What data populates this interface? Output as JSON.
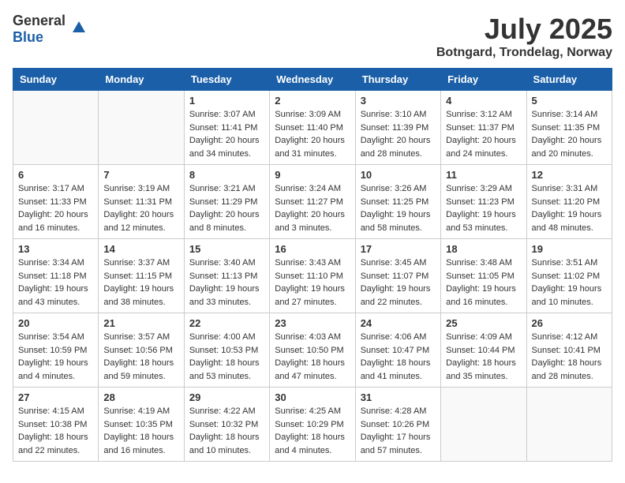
{
  "header": {
    "logo_general": "General",
    "logo_blue": "Blue",
    "month_year": "July 2025",
    "location": "Botngard, Trondelag, Norway"
  },
  "weekdays": [
    "Sunday",
    "Monday",
    "Tuesday",
    "Wednesday",
    "Thursday",
    "Friday",
    "Saturday"
  ],
  "weeks": [
    [
      {
        "day": "",
        "info": ""
      },
      {
        "day": "",
        "info": ""
      },
      {
        "day": "1",
        "info": "Sunrise: 3:07 AM\nSunset: 11:41 PM\nDaylight: 20 hours\nand 34 minutes."
      },
      {
        "day": "2",
        "info": "Sunrise: 3:09 AM\nSunset: 11:40 PM\nDaylight: 20 hours\nand 31 minutes."
      },
      {
        "day": "3",
        "info": "Sunrise: 3:10 AM\nSunset: 11:39 PM\nDaylight: 20 hours\nand 28 minutes."
      },
      {
        "day": "4",
        "info": "Sunrise: 3:12 AM\nSunset: 11:37 PM\nDaylight: 20 hours\nand 24 minutes."
      },
      {
        "day": "5",
        "info": "Sunrise: 3:14 AM\nSunset: 11:35 PM\nDaylight: 20 hours\nand 20 minutes."
      }
    ],
    [
      {
        "day": "6",
        "info": "Sunrise: 3:17 AM\nSunset: 11:33 PM\nDaylight: 20 hours\nand 16 minutes."
      },
      {
        "day": "7",
        "info": "Sunrise: 3:19 AM\nSunset: 11:31 PM\nDaylight: 20 hours\nand 12 minutes."
      },
      {
        "day": "8",
        "info": "Sunrise: 3:21 AM\nSunset: 11:29 PM\nDaylight: 20 hours\nand 8 minutes."
      },
      {
        "day": "9",
        "info": "Sunrise: 3:24 AM\nSunset: 11:27 PM\nDaylight: 20 hours\nand 3 minutes."
      },
      {
        "day": "10",
        "info": "Sunrise: 3:26 AM\nSunset: 11:25 PM\nDaylight: 19 hours\nand 58 minutes."
      },
      {
        "day": "11",
        "info": "Sunrise: 3:29 AM\nSunset: 11:23 PM\nDaylight: 19 hours\nand 53 minutes."
      },
      {
        "day": "12",
        "info": "Sunrise: 3:31 AM\nSunset: 11:20 PM\nDaylight: 19 hours\nand 48 minutes."
      }
    ],
    [
      {
        "day": "13",
        "info": "Sunrise: 3:34 AM\nSunset: 11:18 PM\nDaylight: 19 hours\nand 43 minutes."
      },
      {
        "day": "14",
        "info": "Sunrise: 3:37 AM\nSunset: 11:15 PM\nDaylight: 19 hours\nand 38 minutes."
      },
      {
        "day": "15",
        "info": "Sunrise: 3:40 AM\nSunset: 11:13 PM\nDaylight: 19 hours\nand 33 minutes."
      },
      {
        "day": "16",
        "info": "Sunrise: 3:43 AM\nSunset: 11:10 PM\nDaylight: 19 hours\nand 27 minutes."
      },
      {
        "day": "17",
        "info": "Sunrise: 3:45 AM\nSunset: 11:07 PM\nDaylight: 19 hours\nand 22 minutes."
      },
      {
        "day": "18",
        "info": "Sunrise: 3:48 AM\nSunset: 11:05 PM\nDaylight: 19 hours\nand 16 minutes."
      },
      {
        "day": "19",
        "info": "Sunrise: 3:51 AM\nSunset: 11:02 PM\nDaylight: 19 hours\nand 10 minutes."
      }
    ],
    [
      {
        "day": "20",
        "info": "Sunrise: 3:54 AM\nSunset: 10:59 PM\nDaylight: 19 hours\nand 4 minutes."
      },
      {
        "day": "21",
        "info": "Sunrise: 3:57 AM\nSunset: 10:56 PM\nDaylight: 18 hours\nand 59 minutes."
      },
      {
        "day": "22",
        "info": "Sunrise: 4:00 AM\nSunset: 10:53 PM\nDaylight: 18 hours\nand 53 minutes."
      },
      {
        "day": "23",
        "info": "Sunrise: 4:03 AM\nSunset: 10:50 PM\nDaylight: 18 hours\nand 47 minutes."
      },
      {
        "day": "24",
        "info": "Sunrise: 4:06 AM\nSunset: 10:47 PM\nDaylight: 18 hours\nand 41 minutes."
      },
      {
        "day": "25",
        "info": "Sunrise: 4:09 AM\nSunset: 10:44 PM\nDaylight: 18 hours\nand 35 minutes."
      },
      {
        "day": "26",
        "info": "Sunrise: 4:12 AM\nSunset: 10:41 PM\nDaylight: 18 hours\nand 28 minutes."
      }
    ],
    [
      {
        "day": "27",
        "info": "Sunrise: 4:15 AM\nSunset: 10:38 PM\nDaylight: 18 hours\nand 22 minutes."
      },
      {
        "day": "28",
        "info": "Sunrise: 4:19 AM\nSunset: 10:35 PM\nDaylight: 18 hours\nand 16 minutes."
      },
      {
        "day": "29",
        "info": "Sunrise: 4:22 AM\nSunset: 10:32 PM\nDaylight: 18 hours\nand 10 minutes."
      },
      {
        "day": "30",
        "info": "Sunrise: 4:25 AM\nSunset: 10:29 PM\nDaylight: 18 hours\nand 4 minutes."
      },
      {
        "day": "31",
        "info": "Sunrise: 4:28 AM\nSunset: 10:26 PM\nDaylight: 17 hours\nand 57 minutes."
      },
      {
        "day": "",
        "info": ""
      },
      {
        "day": "",
        "info": ""
      }
    ]
  ]
}
